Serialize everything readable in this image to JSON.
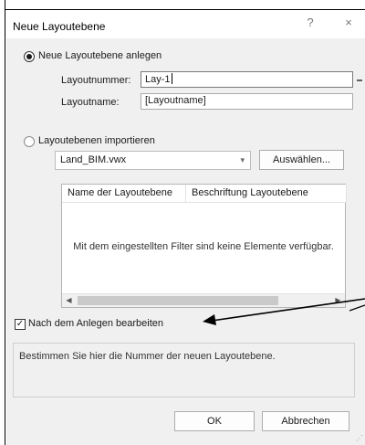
{
  "dialog": {
    "title": "Neue Layoutebene",
    "help_label": "?",
    "close_label": "×"
  },
  "create_section": {
    "radio_label": "Neue Layoutebene anlegen",
    "selected": true,
    "number_label": "Layoutnummer:",
    "number_value": "Lay-1",
    "name_label": "Layoutname:",
    "name_value": "[Layoutname]"
  },
  "import_section": {
    "radio_label": "Layoutebenen importieren",
    "selected": false,
    "file_value": "Land_BIM.vwx",
    "select_button": "Auswählen...",
    "list": {
      "columns": [
        "Name der Layoutebene",
        "Beschriftung Layoutebene"
      ],
      "empty_message": "Mit dem eingestellten Filter sind keine Elemente verfügbar."
    }
  },
  "edit_after_create": {
    "label": "Nach dem Anlegen bearbeiten",
    "checked": true
  },
  "info": {
    "text": "Bestimmen Sie hier die Nummer der neuen Layoutebene."
  },
  "buttons": {
    "ok": "OK",
    "cancel": "Abbrechen"
  },
  "icons": {
    "dropdown": "chevron-down-icon",
    "scroll_left": "arrow-left-icon",
    "scroll_right": "arrow-right-icon",
    "resize": "resize-grip-icon"
  }
}
